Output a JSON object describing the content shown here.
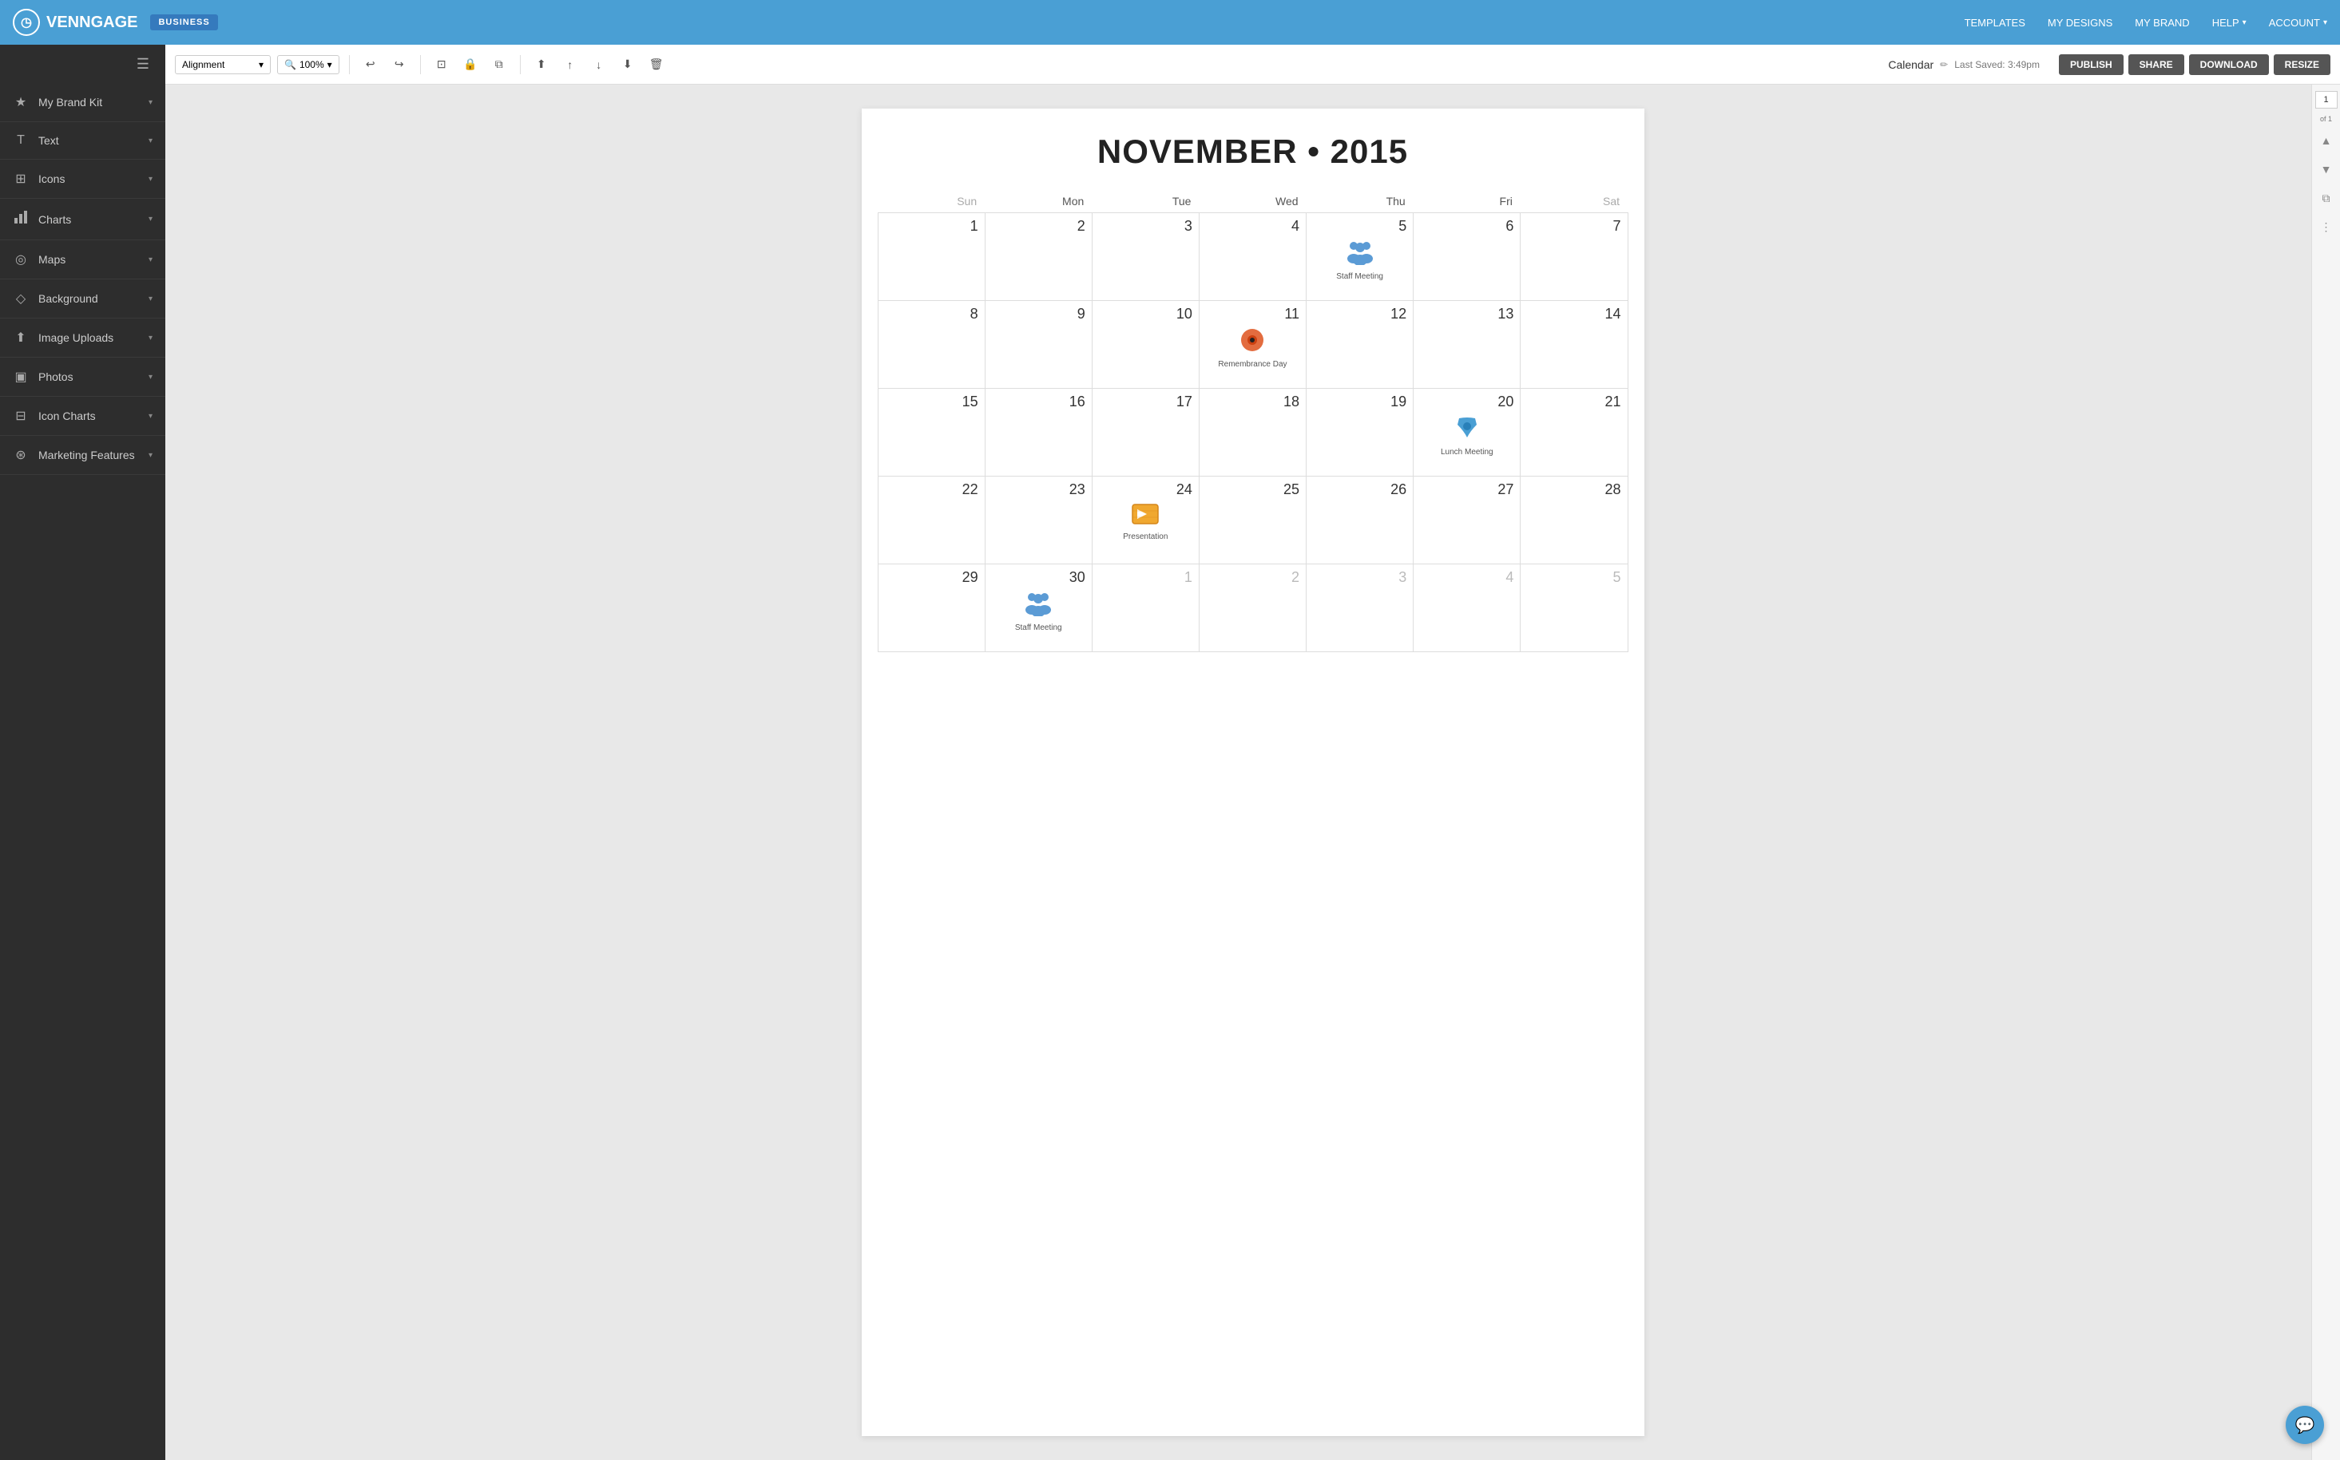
{
  "app": {
    "name": "VENNGAGE",
    "badge": "BUSINESS"
  },
  "nav": {
    "links": [
      "TEMPLATES",
      "MY DESIGNS",
      "MY BRAND",
      "HELP",
      "ACCOUNT"
    ]
  },
  "toolbar": {
    "alignment_label": "Alignment",
    "zoom_label": "100%",
    "calendar_title": "Calendar",
    "last_saved": "Last Saved: 3:49pm",
    "publish": "PUBLISH",
    "share": "SHARE",
    "download": "DOWNLOAD",
    "resize": "RESIZE"
  },
  "sidebar": {
    "items": [
      {
        "label": "My Brand Kit",
        "icon": "★"
      },
      {
        "label": "Text",
        "icon": "T"
      },
      {
        "label": "Icons",
        "icon": "⊞"
      },
      {
        "label": "Charts",
        "icon": "▦"
      },
      {
        "label": "Maps",
        "icon": "◎"
      },
      {
        "label": "Background",
        "icon": "◇"
      },
      {
        "label": "Image Uploads",
        "icon": "⬆"
      },
      {
        "label": "Photos",
        "icon": "▣"
      },
      {
        "label": "Icon Charts",
        "icon": "⊟"
      },
      {
        "label": "Marketing Features",
        "icon": "⊛"
      }
    ]
  },
  "calendar": {
    "title": "NOVEMBER • 2015",
    "days_of_week": [
      "Sun",
      "Mon",
      "Tue",
      "Wed",
      "Thu",
      "Fri",
      "Sat"
    ],
    "weeks": [
      [
        {
          "day": 1,
          "muted": false,
          "event": null
        },
        {
          "day": 2,
          "muted": false,
          "event": null
        },
        {
          "day": 3,
          "muted": false,
          "event": null
        },
        {
          "day": 4,
          "muted": false,
          "event": null
        },
        {
          "day": 5,
          "muted": false,
          "event": {
            "type": "staff-meeting",
            "label": "Staff Meeting",
            "icon": "👥"
          }
        },
        {
          "day": 6,
          "muted": false,
          "event": null
        },
        {
          "day": 7,
          "muted": false,
          "event": null
        }
      ],
      [
        {
          "day": 8,
          "muted": false,
          "event": null
        },
        {
          "day": 9,
          "muted": false,
          "event": null
        },
        {
          "day": 10,
          "muted": false,
          "event": null
        },
        {
          "day": 11,
          "muted": false,
          "event": {
            "type": "remembrance-day",
            "label": "Remembrance Day",
            "icon": "🌺"
          }
        },
        {
          "day": 12,
          "muted": false,
          "event": null
        },
        {
          "day": 13,
          "muted": false,
          "event": null
        },
        {
          "day": 14,
          "muted": false,
          "event": null
        }
      ],
      [
        {
          "day": 15,
          "muted": false,
          "event": null
        },
        {
          "day": 16,
          "muted": false,
          "event": null
        },
        {
          "day": 17,
          "muted": false,
          "event": null
        },
        {
          "day": 18,
          "muted": false,
          "event": null
        },
        {
          "day": 19,
          "muted": false,
          "event": null
        },
        {
          "day": 20,
          "muted": false,
          "event": {
            "type": "lunch-meeting",
            "label": "Lunch Meeting",
            "icon": "🍵"
          }
        },
        {
          "day": 21,
          "muted": false,
          "event": null
        }
      ],
      [
        {
          "day": 22,
          "muted": false,
          "event": null
        },
        {
          "day": 23,
          "muted": false,
          "event": null
        },
        {
          "day": 24,
          "muted": false,
          "event": {
            "type": "presentation",
            "label": "Presentation",
            "icon": "✉"
          }
        },
        {
          "day": 25,
          "muted": false,
          "event": null
        },
        {
          "day": 26,
          "muted": false,
          "event": null
        },
        {
          "day": 27,
          "muted": false,
          "event": null
        },
        {
          "day": 28,
          "muted": false,
          "event": null
        }
      ],
      [
        {
          "day": 29,
          "muted": false,
          "event": null
        },
        {
          "day": 30,
          "muted": false,
          "event": {
            "type": "staff-meeting",
            "label": "Staff Meeting",
            "icon": "👥"
          }
        },
        {
          "day": 1,
          "muted": true,
          "event": null
        },
        {
          "day": 2,
          "muted": true,
          "event": null
        },
        {
          "day": 3,
          "muted": true,
          "event": null
        },
        {
          "day": 4,
          "muted": true,
          "event": null
        },
        {
          "day": 5,
          "muted": true,
          "event": null
        }
      ]
    ]
  },
  "page": {
    "current": 1,
    "total": 1
  }
}
